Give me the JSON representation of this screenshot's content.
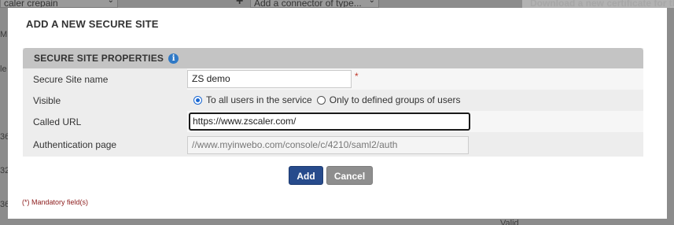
{
  "background": {
    "select_left": "caler crepain",
    "connector_select": "Add a connector of type...",
    "download_link": "Download a new certificate for the service",
    "side_fragments": [
      "M",
      "le",
      "36",
      "32",
      "36"
    ],
    "valid_text": "Valid"
  },
  "modal": {
    "title": "ADD A NEW SECURE SITE",
    "panel_title": "SECURE SITE PROPERTIES",
    "info_icon": "i",
    "fields": {
      "site_name_label": "Secure Site name",
      "site_name_value": "ZS demo",
      "required_mark": "*",
      "visible_label": "Visible",
      "visible_options": [
        "To all users in the service",
        "Only to defined groups of users"
      ],
      "visible_selected": "To all users in the service",
      "called_url_label": "Called URL",
      "called_url_value": "https://www.zscaler.com/",
      "auth_page_label": "Authentication page",
      "auth_page_value": "//www.myinwebo.com/console/c/4210/saml2/auth"
    },
    "buttons": {
      "add": "Add",
      "cancel": "Cancel"
    },
    "mandatory_note": "(*) Mandatory field(s)"
  },
  "colors": {
    "add_button": "#274b8c",
    "cancel_button": "#8e8e8e",
    "panel_header": "#c4c4c4",
    "info_icon": "#2f79c6",
    "required": "#c0392b"
  }
}
